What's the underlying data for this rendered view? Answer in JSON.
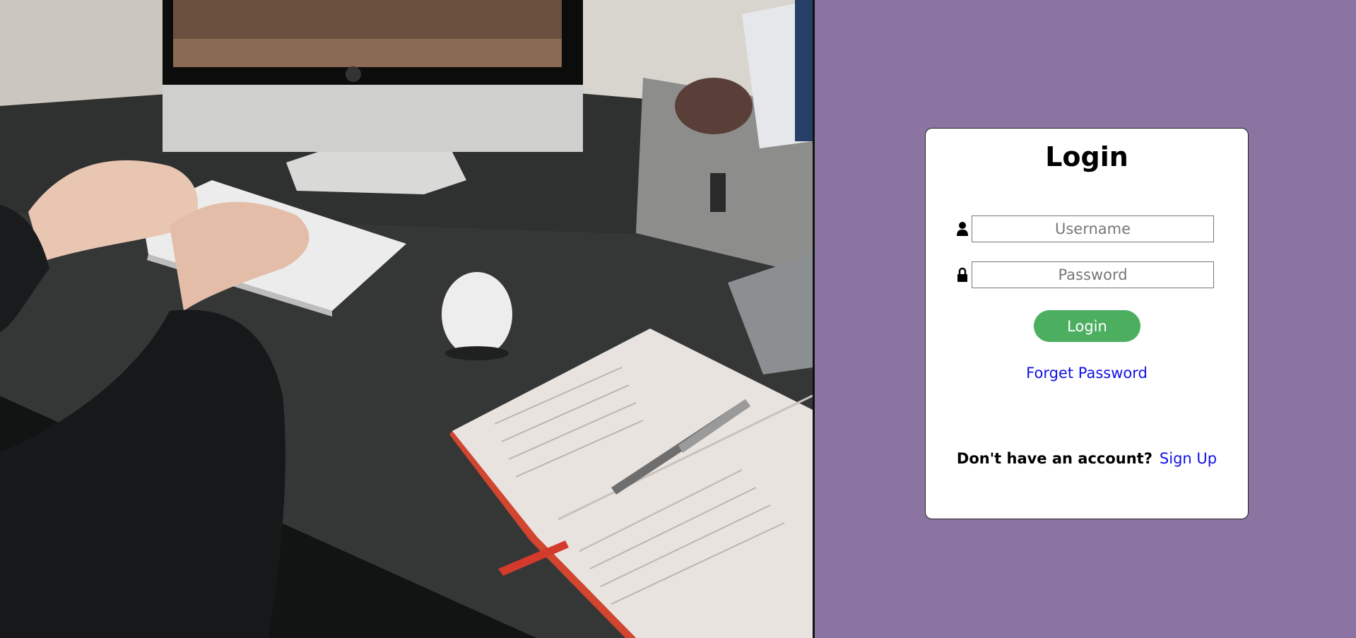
{
  "login_card": {
    "title": "Login",
    "username": {
      "icon": "user-icon",
      "placeholder": "Username",
      "value": ""
    },
    "password": {
      "icon": "lock-icon",
      "placeholder": "Password",
      "value": ""
    },
    "login_button_label": "Login",
    "forget_password_label": "Forget Password",
    "signup_prompt": "Don't have an account?",
    "signup_link_label": "Sign Up"
  },
  "colors": {
    "right_background": "#8c74a2",
    "card_background": "#ffffff",
    "login_button": "#4caf60",
    "link": "#1010e6"
  },
  "photo": {
    "subject": "desk-with-computer-photo"
  }
}
